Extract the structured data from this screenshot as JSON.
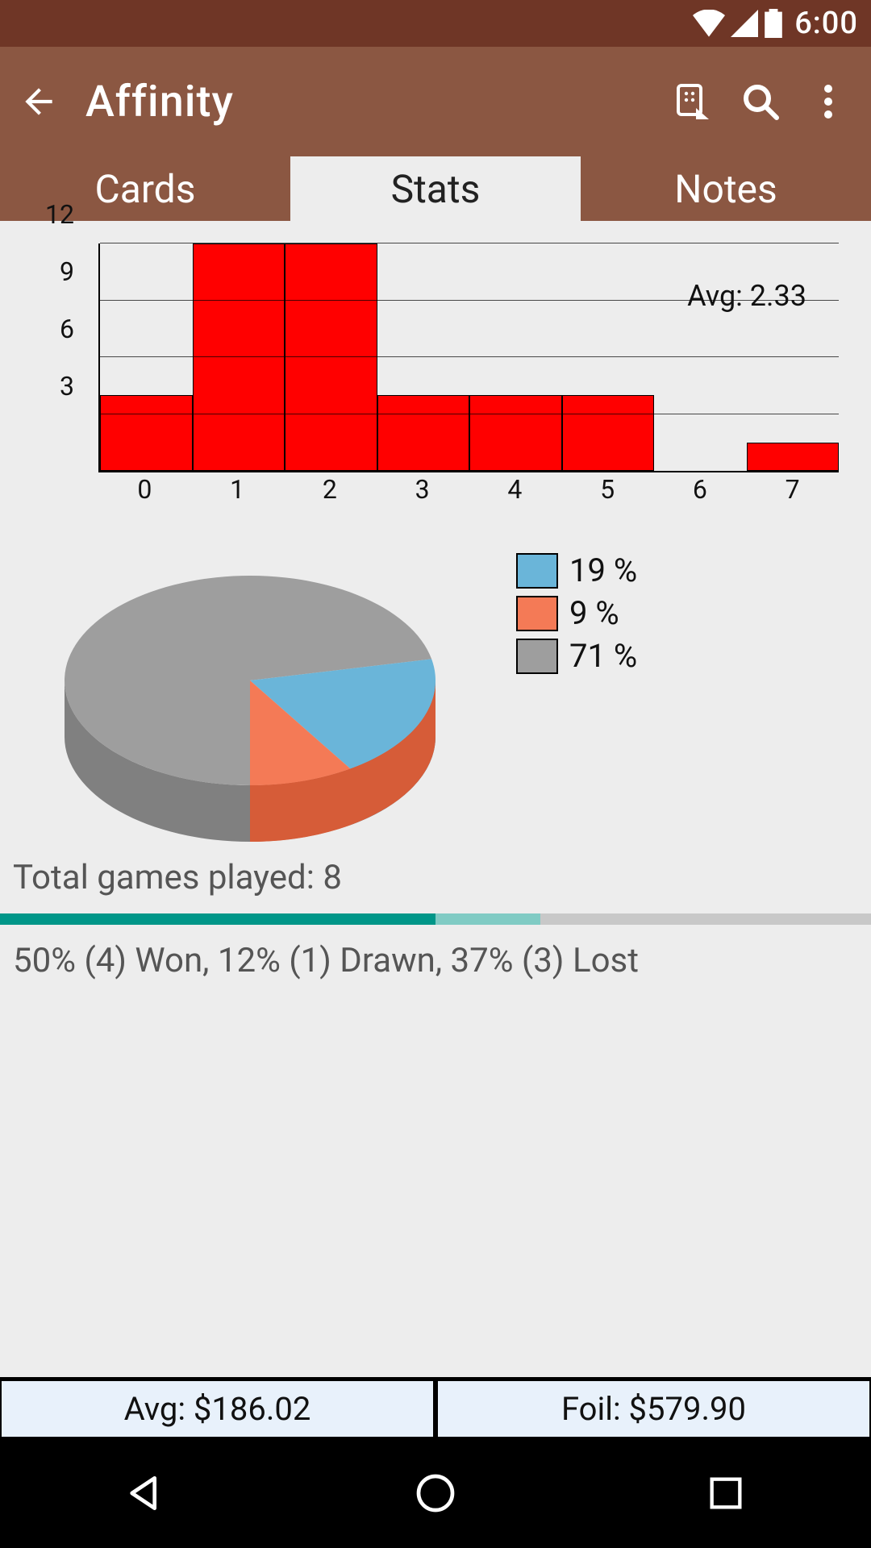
{
  "status": {
    "time": "6:00"
  },
  "appbar": {
    "title": "Affinity"
  },
  "tabs": {
    "cards": "Cards",
    "stats": "Stats",
    "notes": "Notes",
    "active": "stats"
  },
  "chart_data": [
    {
      "type": "bar",
      "categories": [
        "0",
        "1",
        "2",
        "3",
        "4",
        "5",
        "6",
        "7"
      ],
      "values": [
        4,
        12,
        12,
        4,
        4,
        4,
        0,
        1.5
      ],
      "ylim": [
        0,
        12
      ],
      "yticks": [
        3,
        6,
        9,
        12
      ],
      "annotation": "Avg: 2.33",
      "xlabel": "",
      "ylabel": ""
    },
    {
      "type": "pie",
      "series": [
        {
          "name": "blue",
          "value": 19,
          "label": "19 %",
          "color": "#6ab5d9"
        },
        {
          "name": "orange",
          "value": 9,
          "label": "9 %",
          "color": "#f47a56"
        },
        {
          "name": "gray",
          "value": 71,
          "label": "71 %",
          "color": "#9e9e9e"
        }
      ]
    }
  ],
  "games": {
    "total_label": "Total games played: 8",
    "won_pct": 50,
    "drawn_pct": 12,
    "lost_pct": 37,
    "record_label": "50% (4) Won, 12% (1) Drawn, 37% (3) Lost"
  },
  "prices": {
    "avg": "Avg: $186.02",
    "foil": "Foil: $579.90"
  }
}
